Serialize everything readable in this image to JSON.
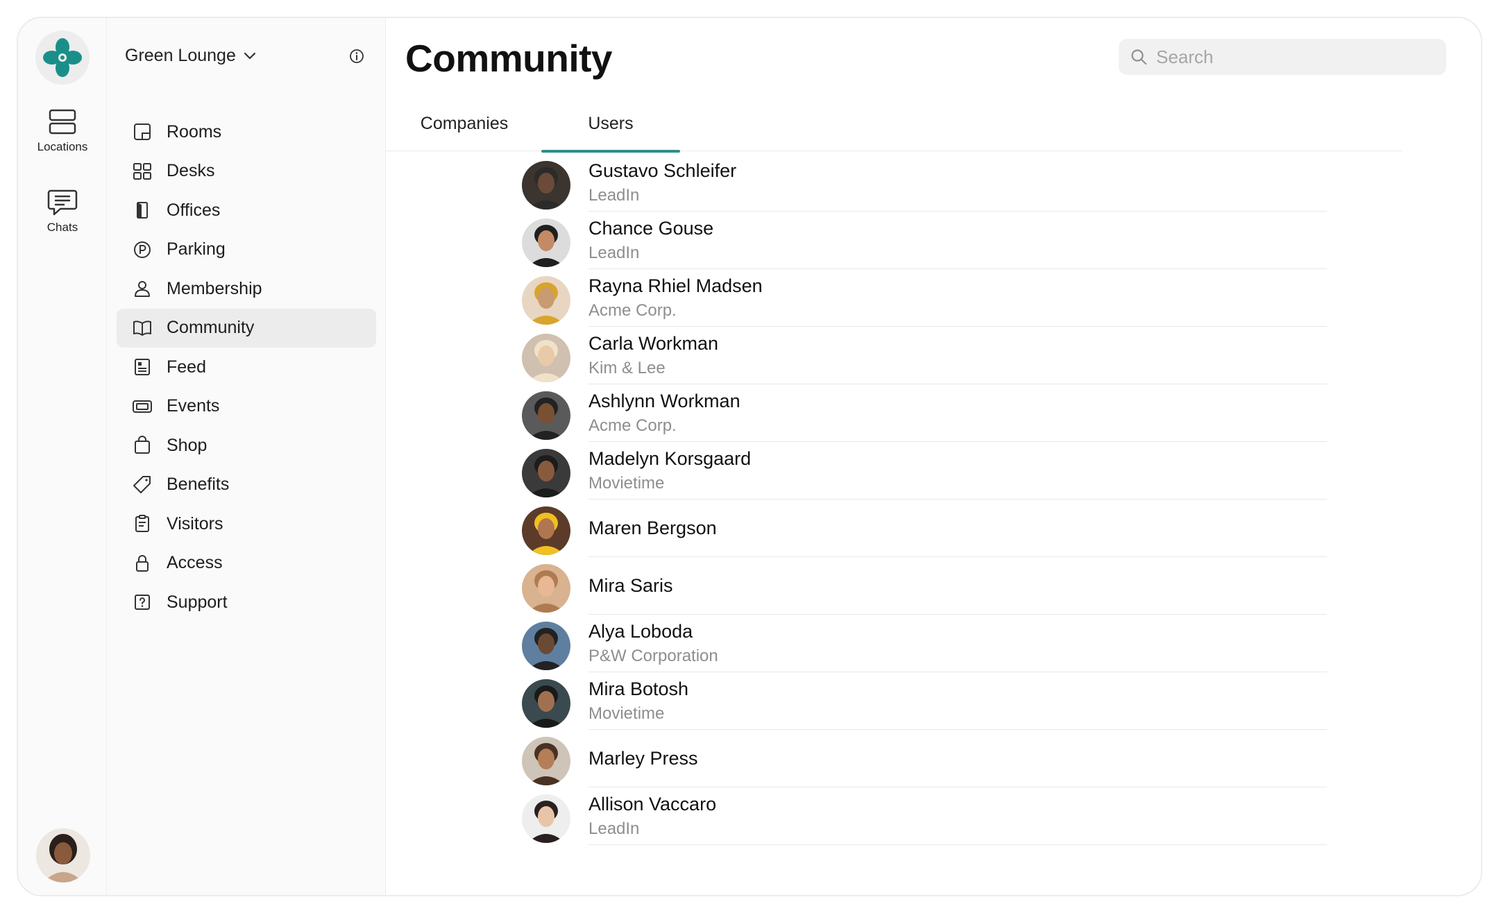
{
  "rail": {
    "items": [
      {
        "label": "Locations",
        "icon": "locations-icon"
      },
      {
        "label": "Chats",
        "icon": "chat-icon"
      }
    ],
    "brand_color": "#1a8f8a"
  },
  "sidebar": {
    "location": "Green Lounge",
    "items": [
      {
        "label": "Rooms",
        "icon": "rooms-icon"
      },
      {
        "label": "Desks",
        "icon": "desks-icon"
      },
      {
        "label": "Offices",
        "icon": "offices-icon"
      },
      {
        "label": "Parking",
        "icon": "parking-icon"
      },
      {
        "label": "Membership",
        "icon": "membership-icon"
      },
      {
        "label": "Community",
        "icon": "book-icon",
        "active": true
      },
      {
        "label": "Feed",
        "icon": "feed-icon"
      },
      {
        "label": "Events",
        "icon": "ticket-icon"
      },
      {
        "label": "Shop",
        "icon": "shopping-bag-icon"
      },
      {
        "label": "Benefits",
        "icon": "tag-icon"
      },
      {
        "label": "Visitors",
        "icon": "clipboard-icon"
      },
      {
        "label": "Access",
        "icon": "lock-icon"
      },
      {
        "label": "Support",
        "icon": "help-icon"
      }
    ]
  },
  "main": {
    "title": "Community",
    "search_placeholder": "Search",
    "tabs": [
      {
        "label": "Companies",
        "active": false
      },
      {
        "label": "Users",
        "active": true
      }
    ],
    "accent": "#2f8d89",
    "users": [
      {
        "name": "Gustavo Schleifer",
        "company": "LeadIn"
      },
      {
        "name": "Chance Gouse",
        "company": "LeadIn"
      },
      {
        "name": "Rayna Rhiel Madsen",
        "company": "Acme Corp."
      },
      {
        "name": "Carla Workman",
        "company": "Kim & Lee"
      },
      {
        "name": "Ashlynn Workman",
        "company": "Acme Corp."
      },
      {
        "name": "Madelyn Korsgaard",
        "company": "Movietime"
      },
      {
        "name": "Maren Bergson",
        "company": ""
      },
      {
        "name": "Mira Saris",
        "company": ""
      },
      {
        "name": "Alya Loboda",
        "company": "P&W Corporation"
      },
      {
        "name": "Mira Botosh",
        "company": "Movietime"
      },
      {
        "name": "Marley Press",
        "company": ""
      },
      {
        "name": "Allison Vaccaro",
        "company": "LeadIn"
      }
    ]
  }
}
